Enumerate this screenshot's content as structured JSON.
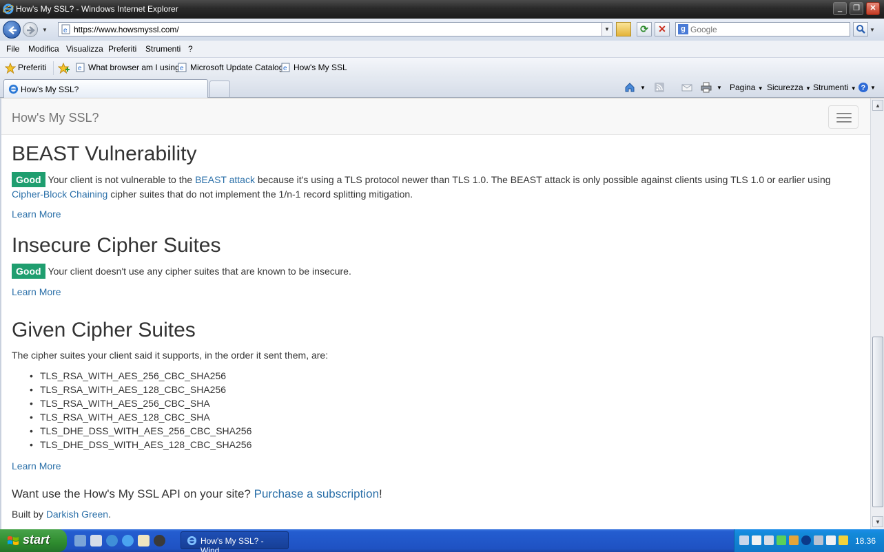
{
  "window": {
    "title": "How's My SSL? - Windows Internet Explorer"
  },
  "address": {
    "url": "https://www.howsmyssl.com/",
    "search_placeholder": "Google"
  },
  "menu": [
    "File",
    "Modifica",
    "Visualizza",
    "Preferiti",
    "Strumenti",
    "?"
  ],
  "favorites": {
    "label": "Preferiti",
    "items": [
      "What browser am I using",
      "Microsoft Update Catalog",
      "How's My SSL"
    ]
  },
  "tabs": {
    "active_label": "How's My SSL?"
  },
  "commands": {
    "page": "Pagina",
    "security": "Sicurezza",
    "tools": "Strumenti"
  },
  "page": {
    "brand": "How's My SSL?",
    "beast": {
      "heading": "BEAST Vulnerability",
      "badge": "Good",
      "text_before_link": "Your client is not vulnerable to the",
      "link1": "BEAST attack",
      "text_mid": "because it's using a TLS protocol newer than TLS 1.0. The BEAST attack is only possible against clients using TLS 1.0 or earlier using",
      "link2": "Cipher-Block Chaining",
      "text_after": "cipher suites that do not implement the 1/n-1 record splitting mitigation.",
      "learn_more": "Learn More"
    },
    "insecure": {
      "heading": "Insecure Cipher Suites",
      "badge": "Good",
      "text": "Your client doesn't use any cipher suites that are known to be insecure.",
      "learn_more": "Learn More"
    },
    "given": {
      "heading": "Given Cipher Suites",
      "intro": "The cipher suites your client said it supports, in the order it sent them, are:",
      "suites": [
        "TLS_RSA_WITH_AES_256_CBC_SHA256",
        "TLS_RSA_WITH_AES_128_CBC_SHA256",
        "TLS_RSA_WITH_AES_256_CBC_SHA",
        "TLS_RSA_WITH_AES_128_CBC_SHA",
        "TLS_DHE_DSS_WITH_AES_256_CBC_SHA256",
        "TLS_DHE_DSS_WITH_AES_128_CBC_SHA256"
      ],
      "learn_more": "Learn More"
    },
    "api": {
      "text": "Want use the How's My SSL API on your site?",
      "link": "Purchase a subscription",
      "suffix": "!"
    },
    "footer": {
      "prefix": "Built by",
      "link": "Darkish Green",
      "suffix": "."
    }
  },
  "taskbar": {
    "start_label": "start",
    "task_label": "How's My SSL? - Wind...",
    "clock": "18.36"
  },
  "colors": {
    "good_badge": "#1f9e6f",
    "link": "#2a6fa8",
    "taskbar": "#245dd0",
    "start": "#2e8b2e"
  }
}
